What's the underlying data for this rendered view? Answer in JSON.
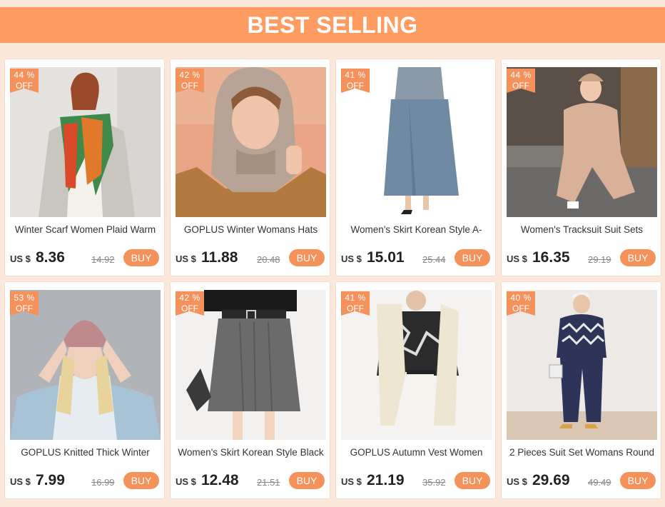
{
  "banner": {
    "title": "BEST SELLING"
  },
  "products": [
    {
      "discount": "44 %",
      "off": "OFF",
      "title": "Winter Scarf Women Plaid Warm",
      "currency": "US $",
      "price": "8.36",
      "old_price": "14.92",
      "buy": "BUY"
    },
    {
      "discount": "42 %",
      "off": "OFF",
      "title": "GOPLUS Winter Womans Hats",
      "currency": "US $",
      "price": "11.88",
      "old_price": "20.48",
      "buy": "BUY"
    },
    {
      "discount": "41 %",
      "off": "OFF",
      "title": "Women's Skirt Korean Style A-",
      "currency": "US $",
      "price": "15.01",
      "old_price": "25.44",
      "buy": "BUY"
    },
    {
      "discount": "44 %",
      "off": "OFF",
      "title": "Women's Tracksuit Suit Sets",
      "currency": "US $",
      "price": "16.35",
      "old_price": "29.19",
      "buy": "BUY"
    },
    {
      "discount": "53 %",
      "off": "OFF",
      "title": "GOPLUS Knitted Thick Winter",
      "currency": "US $",
      "price": "7.99",
      "old_price": "16.99",
      "buy": "BUY"
    },
    {
      "discount": "42 %",
      "off": "OFF",
      "title": "Women's Skirt Korean Style Black",
      "currency": "US $",
      "price": "12.48",
      "old_price": "21.51",
      "buy": "BUY"
    },
    {
      "discount": "41 %",
      "off": "OFF",
      "title": "GOPLUS Autumn Vest Women",
      "currency": "US $",
      "price": "21.19",
      "old_price": "35.92",
      "buy": "BUY"
    },
    {
      "discount": "40 %",
      "off": "OFF",
      "title": "2 Pieces Suit Set Womans Round",
      "currency": "US $",
      "price": "29.69",
      "old_price": "49.49",
      "buy": "BUY"
    }
  ],
  "colors": {
    "accent": "#f5915a",
    "banner": "#ff9c62",
    "background": "#fce8da"
  }
}
